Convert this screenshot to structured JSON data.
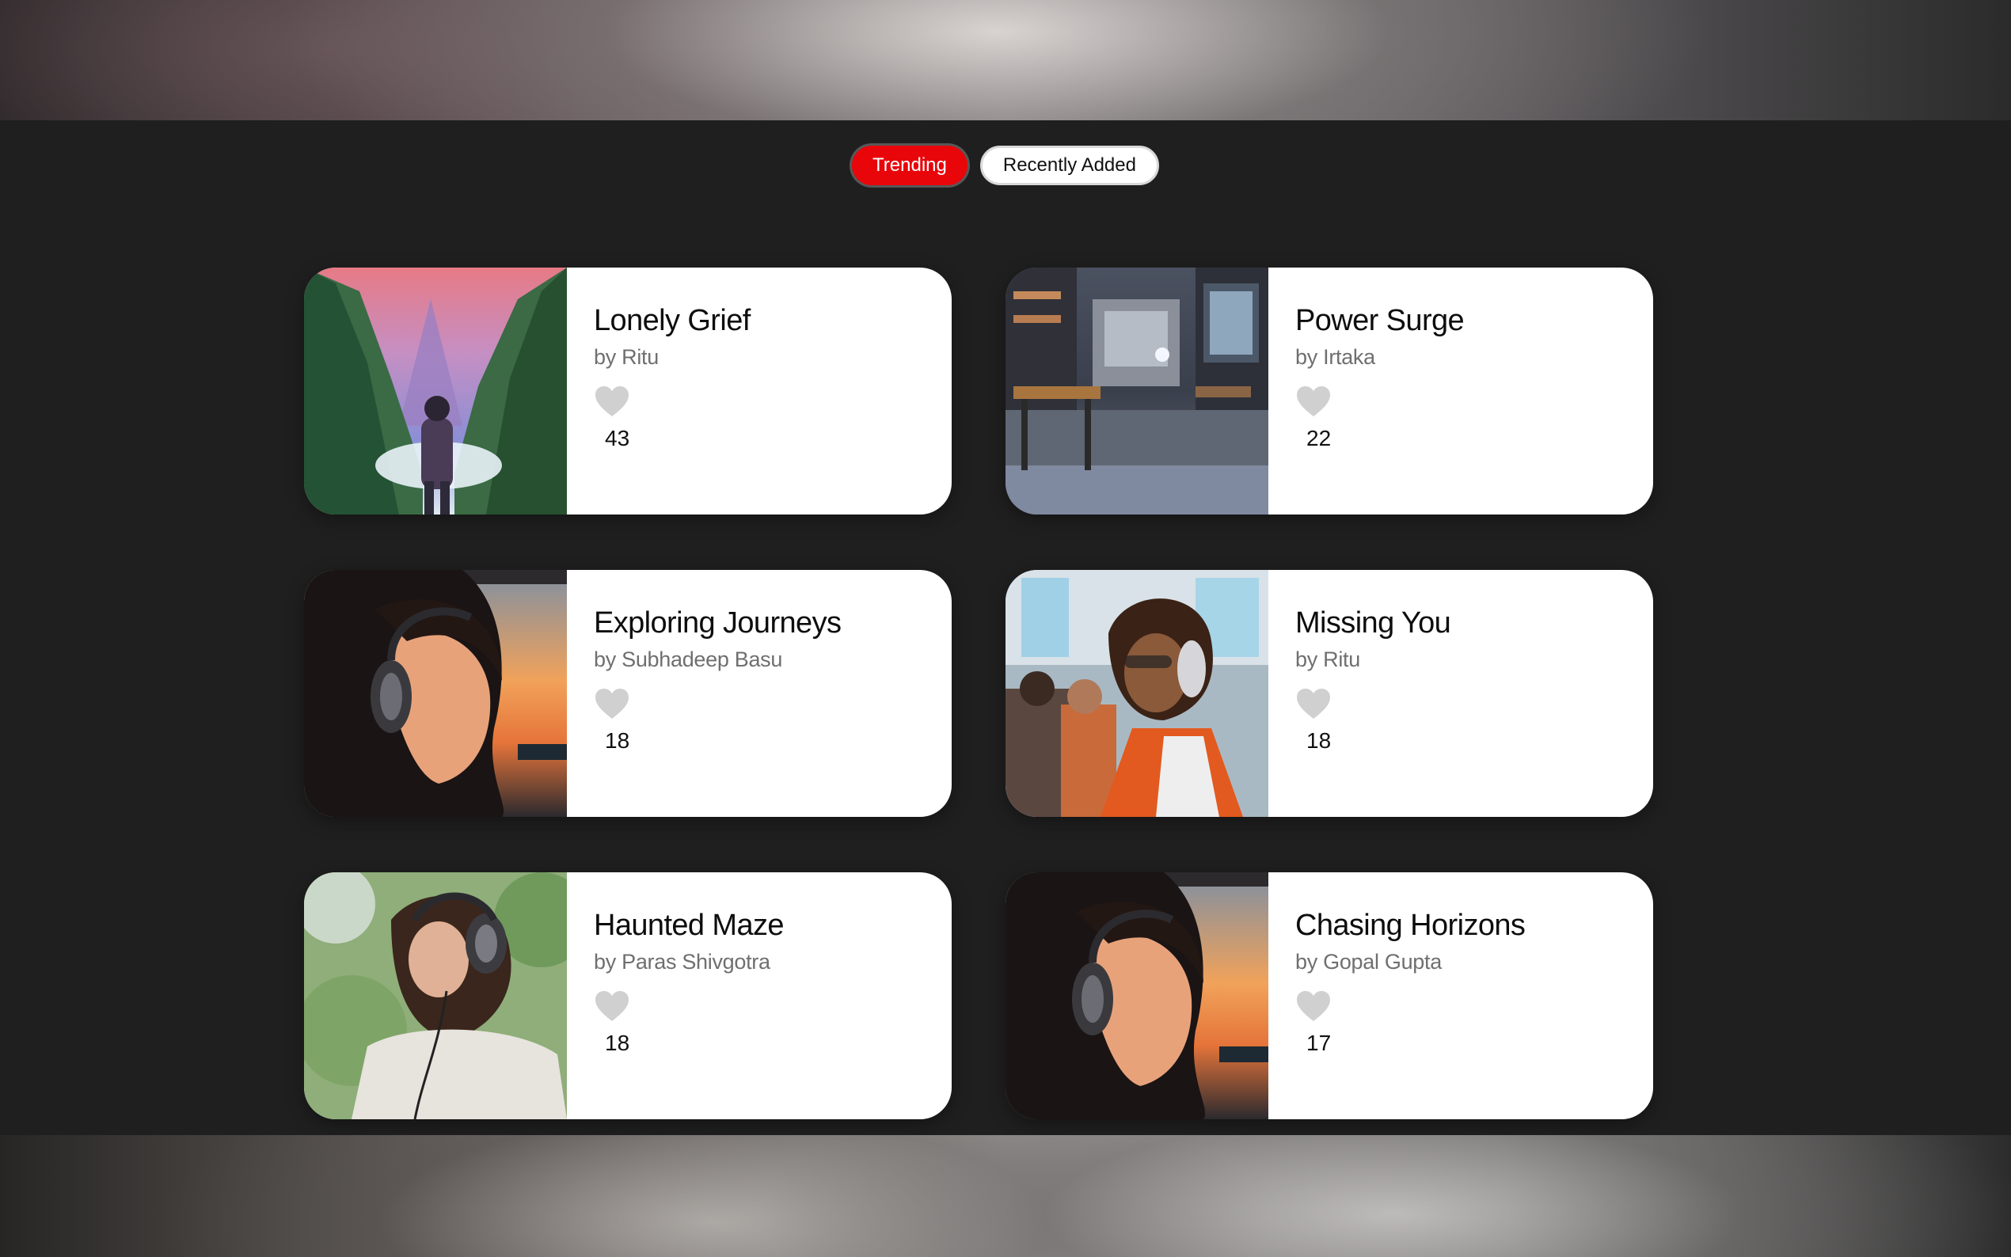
{
  "tabs": [
    {
      "label": "Trending",
      "active": true
    },
    {
      "label": "Recently Added",
      "active": false
    }
  ],
  "songs": [
    {
      "title": "Lonely Grief",
      "artist": "by Ritu",
      "likes": "43",
      "art": "mountain-listener-art"
    },
    {
      "title": "Power Surge",
      "artist": "by Irtaka",
      "likes": "22",
      "art": "futuristic-room-art"
    },
    {
      "title": "Exploring Journeys",
      "artist": "by Subhadeep Basu",
      "likes": "18",
      "art": "sunset-headphones-art"
    },
    {
      "title": "Missing You",
      "artist": "by Ritu",
      "likes": "18",
      "art": "train-headphones-art"
    },
    {
      "title": "Haunted Maze",
      "artist": "by Paras Shivgotra",
      "likes": "18",
      "art": "meadow-headphones-art"
    },
    {
      "title": "Chasing Horizons",
      "artist": "by Gopal Gupta",
      "likes": "17",
      "art": "sunset-headphones-art"
    }
  ],
  "colors": {
    "background": "#1f1f1f",
    "accent": "#e8060b",
    "heart": "#d0d0d0"
  },
  "icons": {
    "like": "heart-icon"
  }
}
